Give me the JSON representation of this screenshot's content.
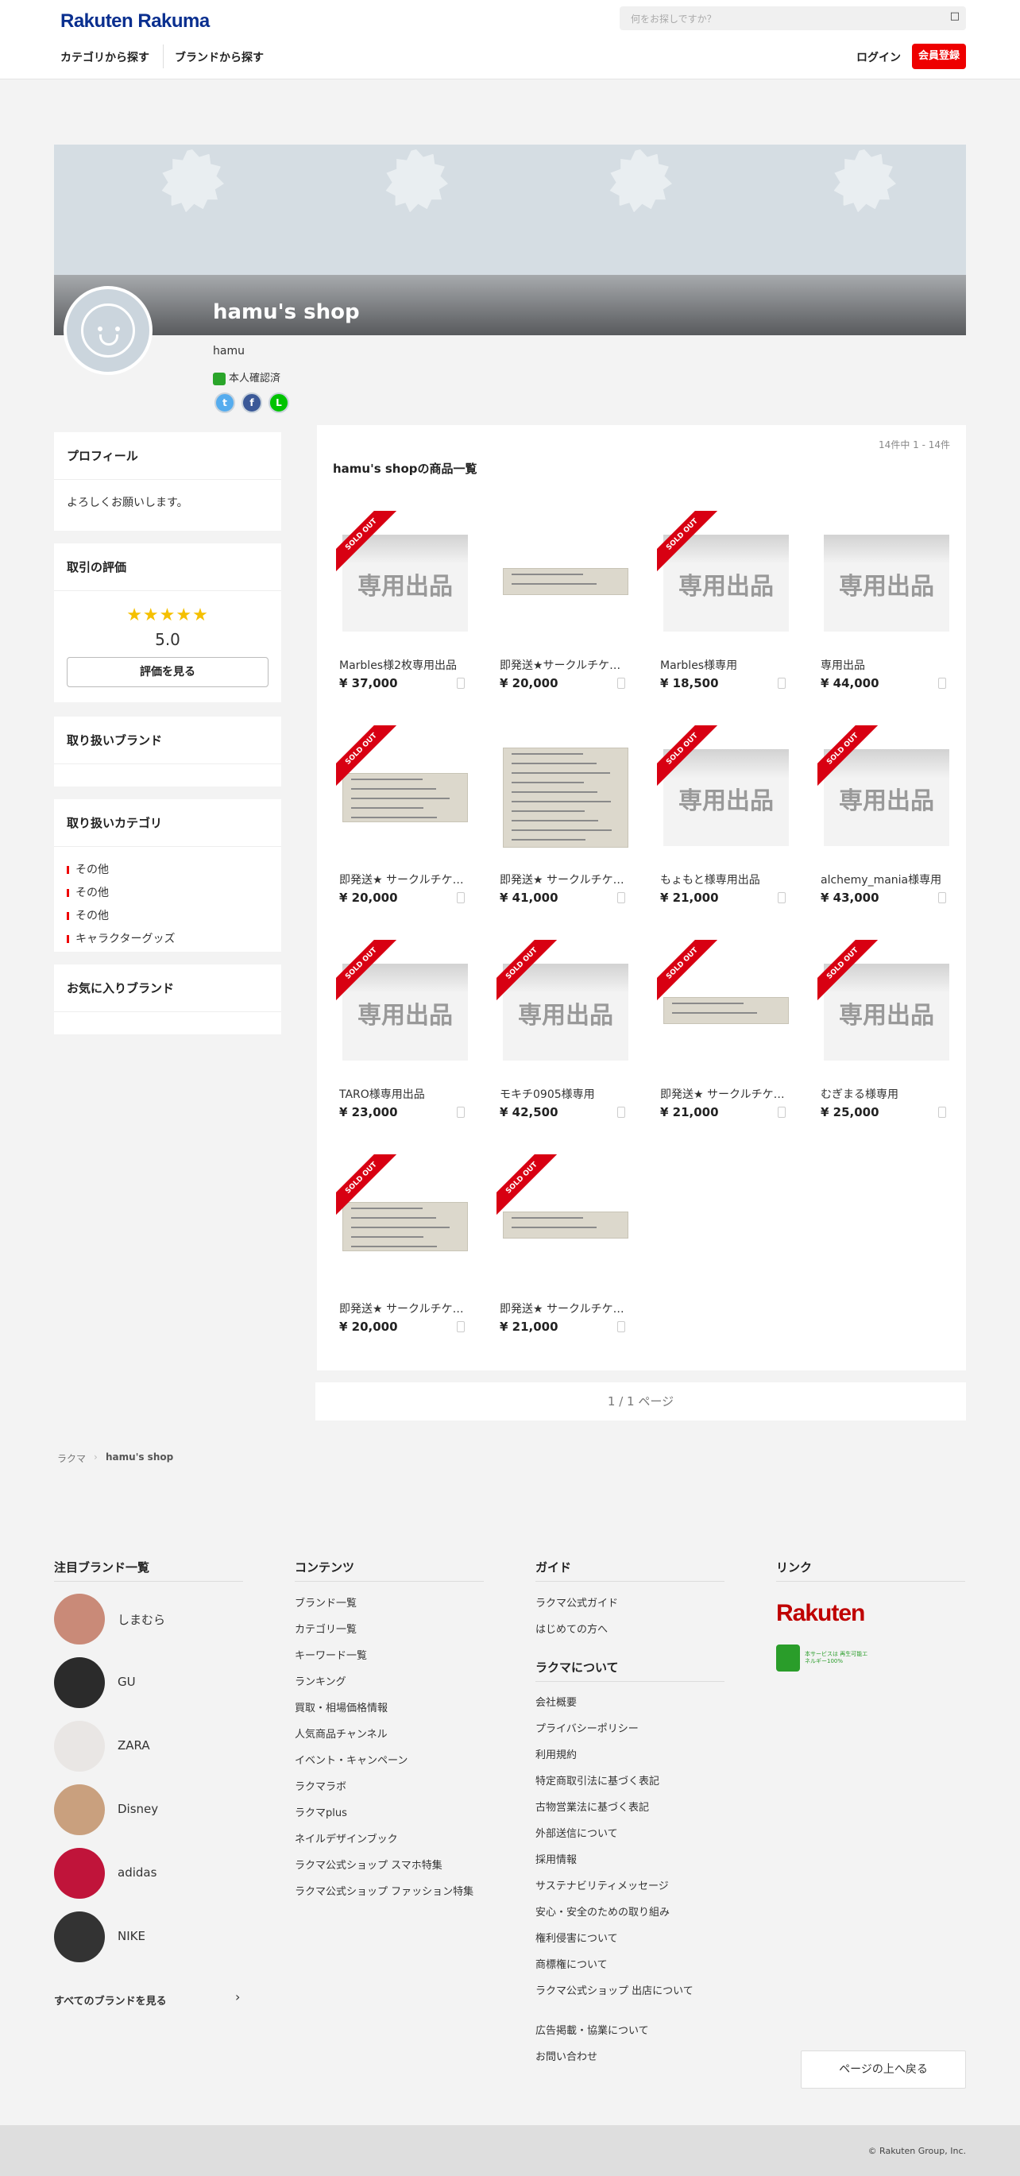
{
  "header": {
    "logo": "Rakuten Rakuma",
    "search_placeholder": "何をお探しですか？",
    "search_icon": "search-icon",
    "nav": [
      "カテゴリから探す",
      "ブランドから探す"
    ],
    "login_label": "ログイン",
    "signup_label": "会員登録",
    "accent_color": "#ee0000"
  },
  "shop": {
    "name": "hamu's shop",
    "username": "hamu",
    "verified_label": "本人確認済",
    "social": [
      "twitter-icon",
      "facebook-icon",
      "line-icon"
    ]
  },
  "sidebar": {
    "profile": {
      "title": "プロフィール",
      "text": "よろしくお願いします。"
    },
    "rating": {
      "title": "取引の評価",
      "stars": "★★★★★",
      "score": "5.0",
      "button": "評価を見る"
    },
    "brands": {
      "title": "取り扱いブランド"
    },
    "categories": {
      "title": "取り扱いカテゴリ",
      "items": [
        "その他",
        "その他",
        "その他",
        "キャラクターグッズ"
      ]
    },
    "favorite_brands": {
      "title": "お気に入りブランド"
    }
  },
  "listing": {
    "count": "14件中 1 - 14件",
    "title": "hamu's shopの商品一覧",
    "sold_label": "SOLD OUT",
    "placeholder_text": "専用出品",
    "items": [
      {
        "name": "Marbles様2枚専用出品",
        "price": "¥ 37,000",
        "sold": true,
        "img": "sen"
      },
      {
        "name": "即発送★サークルチケット",
        "price": "¥ 20,000",
        "sold": false,
        "img": "tkt-thin"
      },
      {
        "name": "Marbles様専用",
        "price": "¥ 18,500",
        "sold": true,
        "img": "sen"
      },
      {
        "name": "専用出品",
        "price": "¥ 44,000",
        "sold": false,
        "img": "sen"
      },
      {
        "name": "即発送★ サークルチケット",
        "price": "¥ 20,000",
        "sold": true,
        "img": "tkt-mid"
      },
      {
        "name": "即発送★ サークルチケット",
        "price": "¥ 41,000",
        "sold": false,
        "img": "tkt-big"
      },
      {
        "name": "もょもと様専用出品",
        "price": "¥ 21,000",
        "sold": true,
        "img": "sen"
      },
      {
        "name": "alchemy_mania様専用",
        "price": "¥ 43,000",
        "sold": true,
        "img": "sen"
      },
      {
        "name": "TARO様専用出品",
        "price": "¥ 23,000",
        "sold": true,
        "img": "sen"
      },
      {
        "name": "モキチ0905様専用",
        "price": "¥ 42,500",
        "sold": true,
        "img": "sen"
      },
      {
        "name": "即発送★ サークルチケット",
        "price": "¥ 21,000",
        "sold": true,
        "img": "tkt-thin"
      },
      {
        "name": "むぎまる様専用",
        "price": "¥ 25,000",
        "sold": true,
        "img": "sen"
      },
      {
        "name": "即発送★ サークルチケット",
        "price": "¥ 20,000",
        "sold": true,
        "img": "tkt-mid"
      },
      {
        "name": "即発送★ サークルチケット",
        "price": "¥ 21,000",
        "sold": true,
        "img": "tkt-thin"
      }
    ],
    "pager": "1 / 1 ページ"
  },
  "breadcrumb": [
    "ラクマ",
    "hamu's shop"
  ],
  "footer": {
    "brands_title": "注目ブランド一覧",
    "brands": [
      "しまむら",
      "GU",
      "ZARA",
      "Disney",
      "adidas",
      "NIKE"
    ],
    "all_brands": "すべてのブランドを見る",
    "contents_title": "コンテンツ",
    "contents": [
      "ブランド一覧",
      "カテゴリ一覧",
      "キーワード一覧",
      "ランキング",
      "買取・相場価格情報",
      "人気商品チャンネル",
      "イベント・キャンペーン",
      "ラクマラボ",
      "ラクマplus",
      "ネイルデザインブック",
      "ラクマ公式ショップ スマホ特集",
      "ラクマ公式ショップ ファッション特集"
    ],
    "guide_title": "ガイド",
    "guide": [
      "ラクマ公式ガイド",
      "はじめての方へ"
    ],
    "about_title": "ラクマについて",
    "about": [
      "会社概要",
      "プライバシーポリシー",
      "利用規約",
      "特定商取引法に基づく表記",
      "古物営業法に基づく表記",
      "外部送信について",
      "採用情報",
      "サステナビリティメッセージ",
      "安心・安全のための取り組み",
      "権利侵害について",
      "商標権について",
      "ラクマ公式ショップ 出店について",
      "広告掲載・協業について",
      "お問い合わせ"
    ],
    "links_title": "リンク",
    "rakuten_logo": "Rakuten",
    "green_text": "本サービスは 再生可能エネルギー100%",
    "to_top": "ページの上へ戻る",
    "copyright": "© Rakuten Group, Inc."
  }
}
